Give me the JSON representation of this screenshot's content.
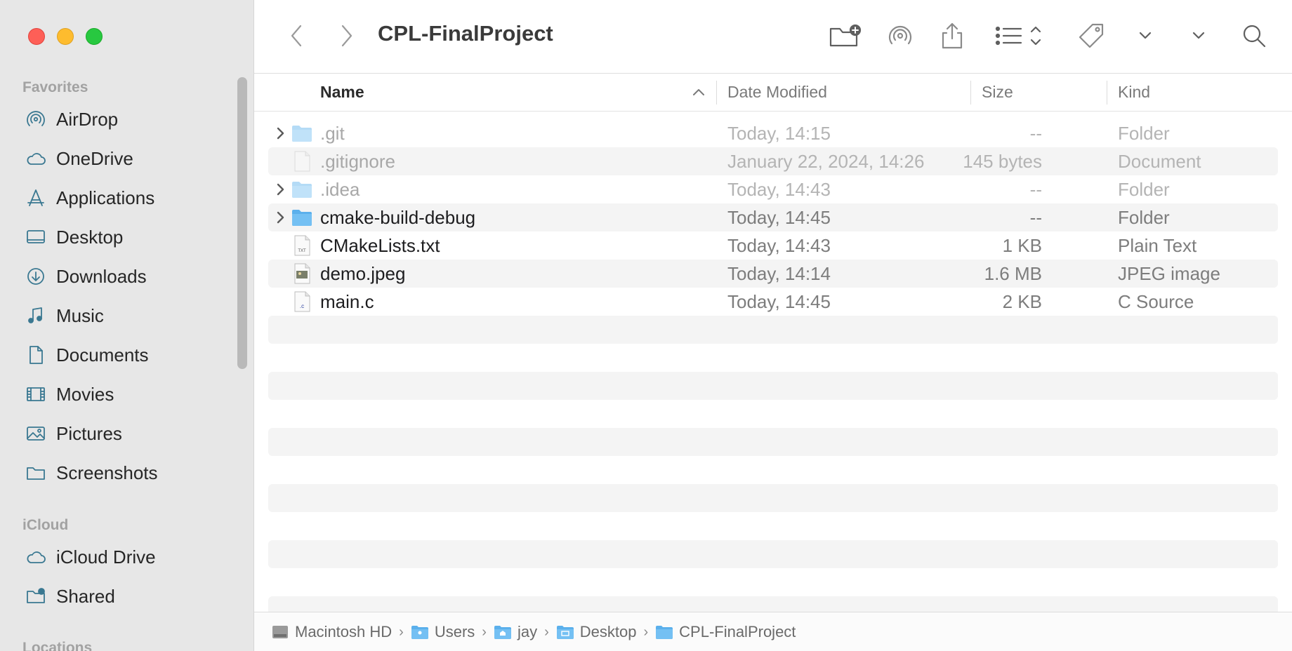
{
  "window": {
    "title": "CPL-FinalProject"
  },
  "sidebar": {
    "favorites_title": "Favorites",
    "favorites": [
      {
        "label": "AirDrop",
        "icon": "airdrop-icon"
      },
      {
        "label": "OneDrive",
        "icon": "cloud-icon"
      },
      {
        "label": "Applications",
        "icon": "applications-icon"
      },
      {
        "label": "Desktop",
        "icon": "desktop-icon"
      },
      {
        "label": "Downloads",
        "icon": "downloads-icon"
      },
      {
        "label": "Music",
        "icon": "music-icon"
      },
      {
        "label": "Documents",
        "icon": "document-icon"
      },
      {
        "label": "Movies",
        "icon": "film-icon"
      },
      {
        "label": "Pictures",
        "icon": "pictures-icon"
      },
      {
        "label": "Screenshots",
        "icon": "folder-icon"
      }
    ],
    "icloud_title": "iCloud",
    "icloud": [
      {
        "label": "iCloud Drive",
        "icon": "cloud-icon"
      },
      {
        "label": "Shared",
        "icon": "shared-folder-icon"
      }
    ],
    "locations_title": "Locations"
  },
  "columns": {
    "name": "Name",
    "date": "Date Modified",
    "size": "Size",
    "kind": "Kind"
  },
  "files": [
    {
      "name": ".git",
      "date": "Today, 14:15",
      "size": "--",
      "kind": "Folder",
      "type": "folder",
      "hidden": true,
      "expandable": true
    },
    {
      "name": ".gitignore",
      "date": "January 22, 2024, 14:26",
      "size": "145 bytes",
      "kind": "Document",
      "type": "document",
      "hidden": true,
      "expandable": false
    },
    {
      "name": ".idea",
      "date": "Today, 14:43",
      "size": "--",
      "kind": "Folder",
      "type": "folder",
      "hidden": true,
      "expandable": true
    },
    {
      "name": "cmake-build-debug",
      "date": "Today, 14:45",
      "size": "--",
      "kind": "Folder",
      "type": "folder",
      "hidden": false,
      "expandable": true
    },
    {
      "name": "CMakeLists.txt",
      "date": "Today, 14:43",
      "size": "1 KB",
      "kind": "Plain Text",
      "type": "text",
      "hidden": false,
      "expandable": false
    },
    {
      "name": "demo.jpeg",
      "date": "Today, 14:14",
      "size": "1.6 MB",
      "kind": "JPEG image",
      "type": "image",
      "hidden": false,
      "expandable": false
    },
    {
      "name": "main.c",
      "date": "Today, 14:45",
      "size": "2 KB",
      "kind": "C Source",
      "type": "csource",
      "hidden": false,
      "expandable": false
    }
  ],
  "pathbar": [
    {
      "label": "Macintosh HD",
      "icon": "harddrive-icon"
    },
    {
      "label": "Users",
      "icon": "users-folder-icon"
    },
    {
      "label": "jay",
      "icon": "home-folder-icon"
    },
    {
      "label": "Desktop",
      "icon": "desktop-folder-icon"
    },
    {
      "label": "CPL-FinalProject",
      "icon": "folder-icon"
    }
  ],
  "colors": {
    "accent_folder": "#4aa3e6",
    "sidebar_icon": "#3a7891",
    "sidebar_bg": "#e7e7e7"
  }
}
